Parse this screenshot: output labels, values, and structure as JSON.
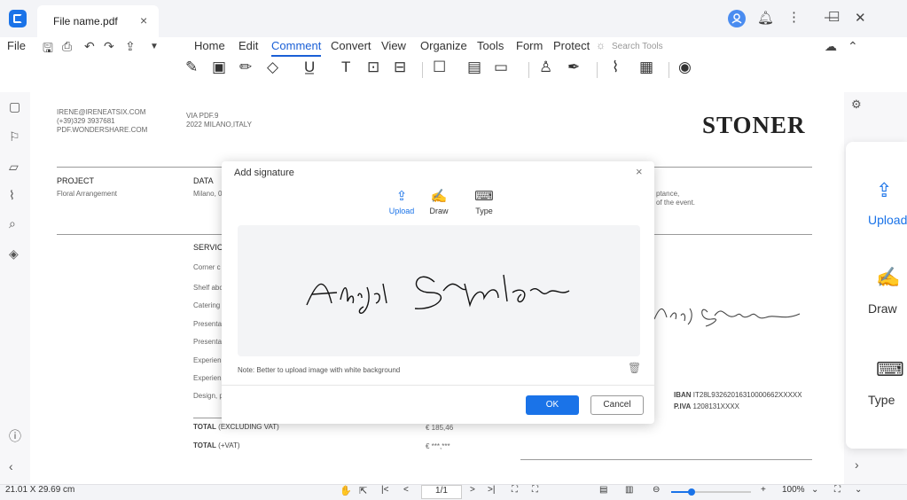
{
  "window": {
    "tab_title": "File name.pdf",
    "tab_close": "×",
    "controls": {
      "minimize": "—",
      "maximize": "☐",
      "close": "✕"
    }
  },
  "menu": {
    "file": "File",
    "items": [
      "Home",
      "Edit",
      "Comment",
      "Convert",
      "View",
      "Organize",
      "Tools",
      "Form",
      "Protect"
    ],
    "active": "Comment",
    "search_placeholder": "Search Tools"
  },
  "document": {
    "contact": [
      "IRENE@IRENEATSIX.COM",
      "(+39)329 3937681",
      "PDF.WONDERSHARE.COM"
    ],
    "address": [
      "VIA PDF.9",
      "2022 MILANO,ITALY"
    ],
    "brand": "STONER",
    "project_label": "PROJECT",
    "project_value": "Floral Arrangement",
    "data_label": "DATA",
    "data_value": "Milano, 0",
    "right_text": [
      "ptance,",
      "of the event."
    ],
    "service_label": "SERVICE",
    "services": [
      "Corner c",
      "Shelf abc",
      "Catering",
      "Presenta",
      "Presenta",
      "Experien",
      "Experien",
      "Design, p"
    ],
    "signature_bg": "Abigail Stanton",
    "iban_label": "IBAN",
    "iban_value": "IT28L93262016310000662XXXXX",
    "piva_label": "P.IVA",
    "piva_value": "1208131XXXX",
    "total_excl_label": "TOTAL",
    "total_excl_suffix": "(EXCLUDING VAT)",
    "total_excl_value": "€ 185,46",
    "total_vat_label": "TOTAL",
    "total_vat_suffix": "(+VAT)",
    "total_vat_value": "€ ***,***"
  },
  "modal": {
    "title": "Add signature",
    "close": "×",
    "tabs": [
      {
        "label": "Upload",
        "icon": "upload-icon"
      },
      {
        "label": "Draw",
        "icon": "draw-icon"
      },
      {
        "label": "Type",
        "icon": "keyboard-icon"
      }
    ],
    "active_tab": "Upload",
    "signature_text": "Abigail Stanton",
    "note": "Note: Better to upload image with white background",
    "ok": "OK",
    "cancel": "Cancel"
  },
  "side_panel": {
    "items": [
      {
        "label": "Upload",
        "icon": "upload-icon"
      },
      {
        "label": "Draw",
        "icon": "draw-icon"
      },
      {
        "label": "Type",
        "icon": "keyboard-icon"
      }
    ]
  },
  "status": {
    "page_size": "21.01 X 29.69 cm",
    "page_indicator": "1/1",
    "zoom": "100%",
    "zoom_fraction": 0.25
  },
  "colors": {
    "accent": "#1a73e8",
    "titlebar": "#f3f4f7"
  }
}
